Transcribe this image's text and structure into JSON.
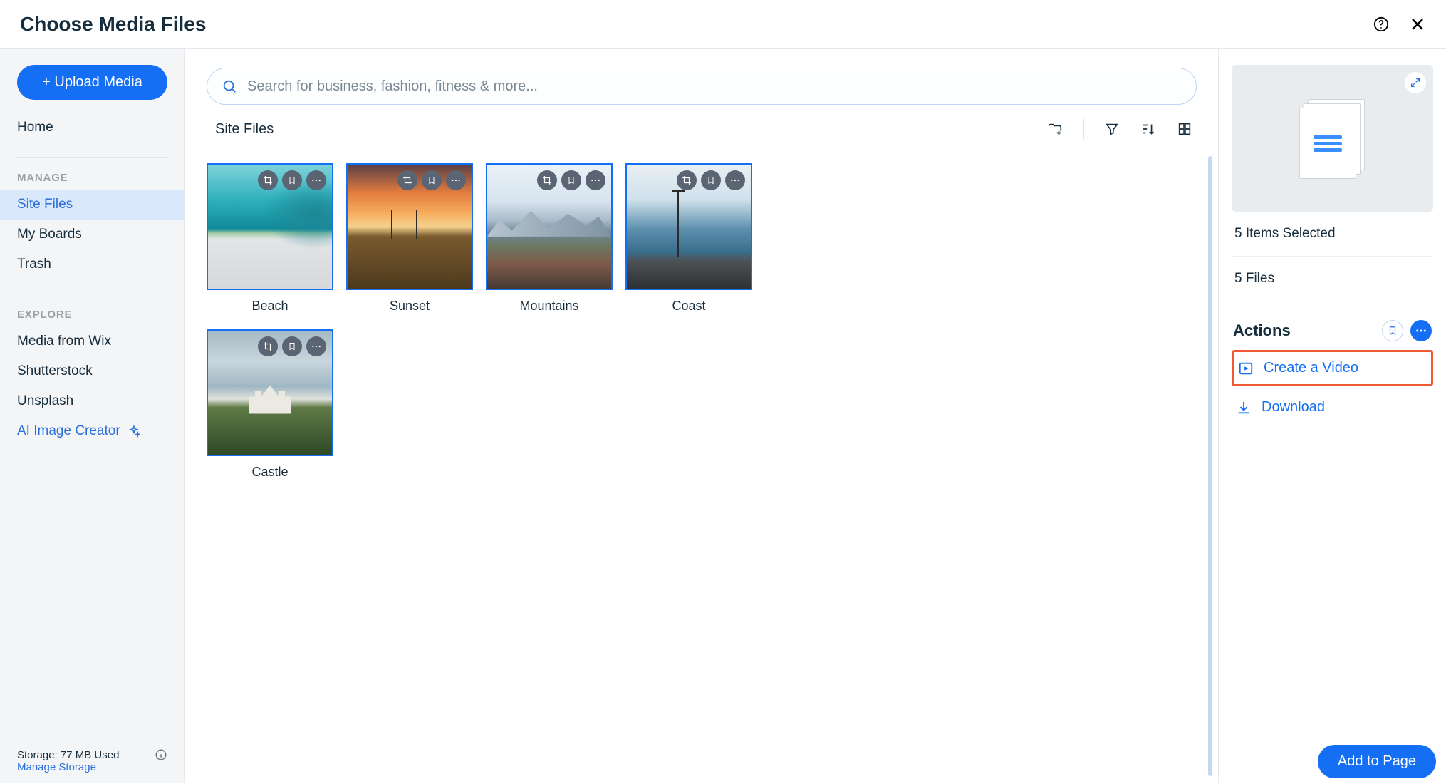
{
  "header": {
    "title": "Choose Media Files"
  },
  "sidebar": {
    "upload_label": "+ Upload Media",
    "home": "Home",
    "manage_label": "MANAGE",
    "manage": [
      {
        "label": "Site Files",
        "active": true
      },
      {
        "label": "My Boards",
        "active": false
      },
      {
        "label": "Trash",
        "active": false
      }
    ],
    "explore_label": "EXPLORE",
    "explore": [
      {
        "label": "Media from Wix"
      },
      {
        "label": "Shutterstock"
      },
      {
        "label": "Unsplash"
      }
    ],
    "ai_creator": "AI Image Creator",
    "storage_text": "Storage: 77 MB Used",
    "manage_storage": "Manage Storage"
  },
  "main": {
    "search_placeholder": "Search for business, fashion, fitness & more...",
    "breadcrumb": "Site Files",
    "files": [
      {
        "name": "Beach",
        "scene": "scene-beach"
      },
      {
        "name": "Sunset",
        "scene": "scene-sunset"
      },
      {
        "name": "Mountains",
        "scene": "scene-mountains"
      },
      {
        "name": "Coast",
        "scene": "scene-coast"
      },
      {
        "name": "Castle",
        "scene": "scene-castle"
      }
    ]
  },
  "panel": {
    "selected_text": "5 Items Selected",
    "files_text": "5 Files",
    "actions_label": "Actions",
    "create_video": "Create a Video",
    "download": "Download"
  },
  "footer": {
    "add_to_page": "Add to Page"
  }
}
